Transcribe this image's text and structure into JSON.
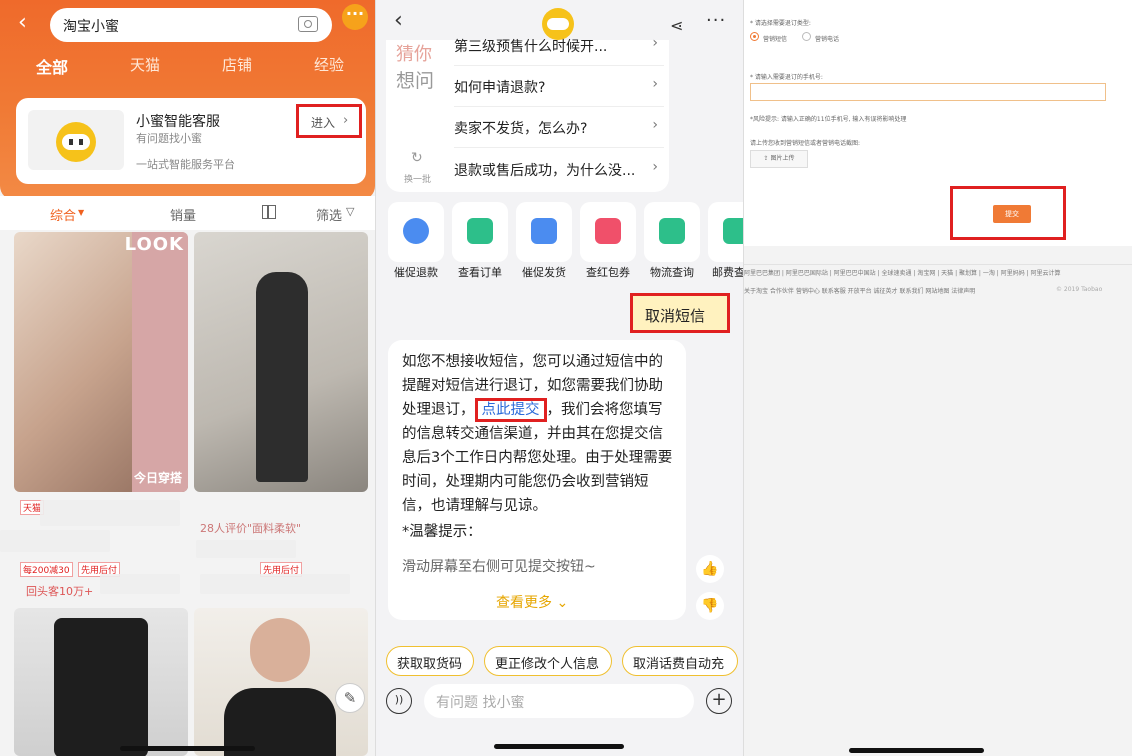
{
  "panel1": {
    "search_text": "淘宝小蜜",
    "tabs": [
      "全部",
      "天猫",
      "店铺",
      "经验"
    ],
    "shop": {
      "name": "小蜜智能客服",
      "sub1": "有问题找小蜜",
      "sub2": "一站式智能服务平台",
      "enter_label": "进入"
    },
    "sort": [
      "综合",
      "销量",
      "筛选"
    ],
    "product1": {
      "look": "LOOK",
      "today": "今日穿搭"
    },
    "product2": {
      "review": "28人评价\"面料柔软\""
    },
    "tags": {
      "coupon": "每200减30",
      "pay_later": "先用后付",
      "repeat": "回头客10万+",
      "tmall": "天猫"
    }
  },
  "panel2": {
    "faq_side_top": "猜你",
    "faq_side": "想问",
    "faq_refresh": "换一批",
    "faq_items": [
      "第三级预售什么时候开...",
      "如何申请退款?",
      "卖家不发货，怎么办?",
      "退款或售后成功，为什么没..."
    ],
    "quick_actions": [
      "催促退款",
      "查看订单",
      "催促发货",
      "查红包券",
      "物流查询",
      "邮费查"
    ],
    "cancel_sms": "取消短信",
    "message": {
      "part1": "如您不想接收短信，您可以通过短信中的提醒对短信进行退订，如您需要我们协助处理退订，",
      "link": "点此提交",
      "part2": "，我们会将您填写的信息转交通信渠道，并由其在您提交信息后3个工作日内帮您处理。由于处理需要时间，处理期内可能您仍会收到营销短信，也请理解与见谅。",
      "tip_title": "*温馨提示：",
      "tip_body": "滑动屏幕至右侧可见提交按钮~",
      "more": "查看更多"
    },
    "chips": [
      "获取取货码",
      "更正修改个人信息",
      "取消话费自动充"
    ],
    "input_placeholder": "有问题 找小蜜"
  },
  "panel3": {
    "q1": "* 请选择需要退订类型:",
    "radio1": "营销短信",
    "radio2": "营销电话",
    "q2": "* 请输入需要退订的手机号:",
    "risk": "*风险提示: 请输入正确的11位手机号, 输入有误将影响处理",
    "upload_hint": "请上传您收到营销短信或者营销电话截图:",
    "upload_btn": "图片上传",
    "submit": "提交",
    "footer1": "阿里巴巴集团 | 阿里巴巴国际站 | 阿里巴巴中国站 | 全球速卖通 | 淘宝网 | 天猫 | 聚划算 | 一淘 | 阿里妈妈 | 阿里云计算",
    "footer2": "关于淘宝  合作伙伴  营销中心  联系客服  开放平台  诚征英才  联系我们  网站地图  法律声明",
    "copyright": "© 2019 Taobao"
  }
}
